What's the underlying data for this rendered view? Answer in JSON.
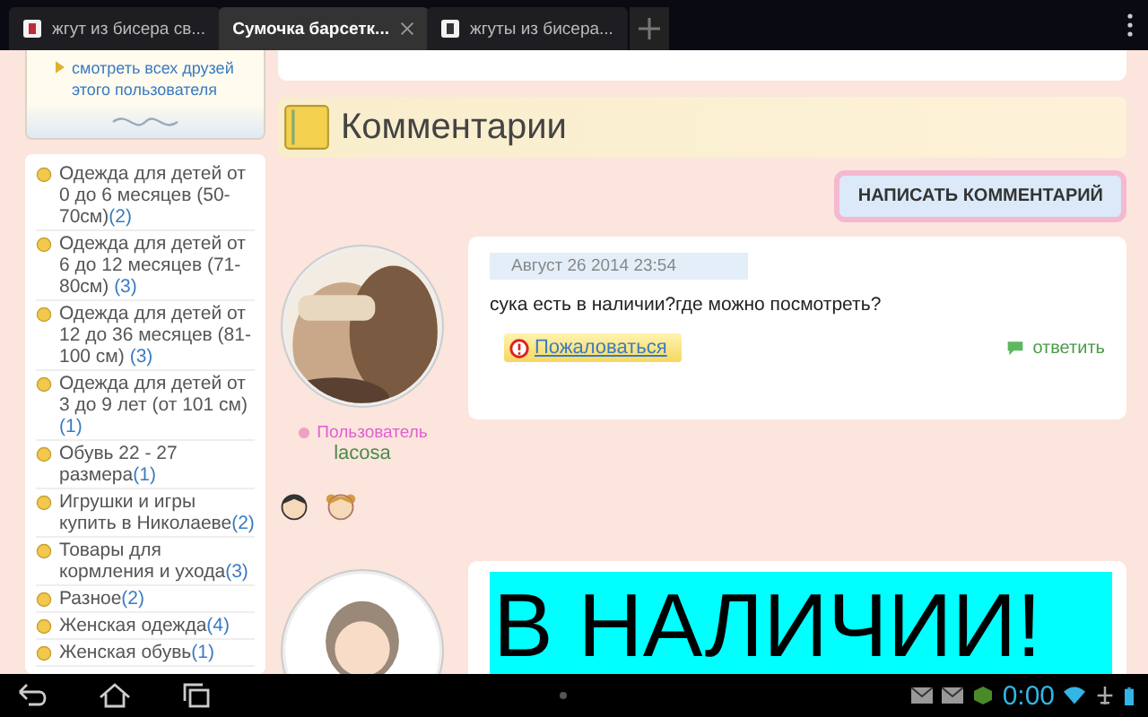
{
  "tabs": [
    {
      "title": "жгут из бисера св...",
      "selected": false
    },
    {
      "title": "Сумочка барсетк...",
      "selected": true
    },
    {
      "title": "жгуты из бисера...",
      "selected": false
    }
  ],
  "sidebar": {
    "friends_link": "смотреть всех друзей этого пользователя",
    "categories": [
      {
        "name": "Одежда для детей от 0 до 6 месяцев (50-70см)",
        "count": "(2)"
      },
      {
        "name": "Одежда для детей от 6 до 12 месяцев (71-80см) ",
        "count": "(3)"
      },
      {
        "name": "Одежда для детей от 12 до 36 месяцев (81-100 см) ",
        "count": "(3)"
      },
      {
        "name": "Одежда для детей от 3 до 9 лет (от 101 см) ",
        "count": "(1)"
      },
      {
        "name": "Обувь 22 - 27 размера",
        "count": "(1)"
      },
      {
        "name": "Игрушки и игры купить в Николаеве",
        "count": "(2)"
      },
      {
        "name": "Товары для кормления и ухода",
        "count": "(3)"
      },
      {
        "name": "Разное",
        "count": "(2)"
      },
      {
        "name": "Женская одежда",
        "count": "(4)"
      },
      {
        "name": "Женская обувь",
        "count": "(1)"
      }
    ]
  },
  "section_title": "Комментарии",
  "write_button": "НАПИСАТЬ КОММЕНТАРИЙ",
  "comments": [
    {
      "kind": "text",
      "date": "Август 26 2014 23:54",
      "text": "сука есть в наличии?где можно посмотреть?",
      "complain": "Пожаловаться",
      "reply": "ответить",
      "role": "Пользователь",
      "user": "lacosa"
    },
    {
      "kind": "highlight",
      "text": "В НАЛИЧИИ!"
    }
  ],
  "status_bar": {
    "time": "0:00"
  }
}
